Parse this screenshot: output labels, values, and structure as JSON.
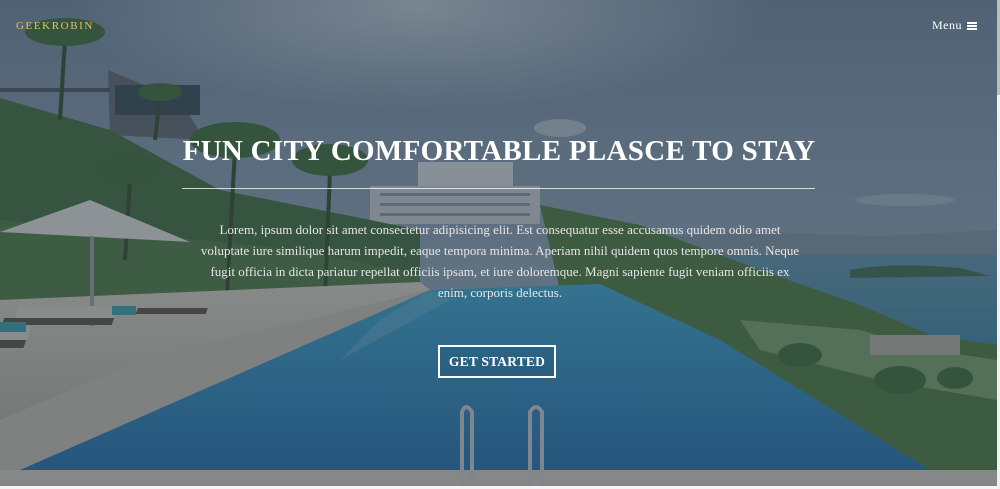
{
  "brand": {
    "name": "GEEKROBIN"
  },
  "nav": {
    "menu_label": "Menu"
  },
  "hero": {
    "headline": "FUN CITY COMFORTABLE PLASCE TO STAY",
    "lead": "Lorem, ipsum dolor sit amet consectetur adipisicing elit. Est consequatur esse accusamus quidem odio amet voluptate iure similique harum impedit, eaque tempora minima. Aperiam nihil quidem quos tempore omnis. Neque fugit officia in dicta pariatur repellat officiis ipsam, et iure doloremque. Magni sapiente fugit veniam officiis ex enim, corporis delectus.",
    "cta_label": "GET STARTED"
  },
  "icons": {
    "menu": "hamburger-icon"
  },
  "colors": {
    "brand": "#e8c15a",
    "text": "#ffffff",
    "overlay": "#2f3a44"
  }
}
